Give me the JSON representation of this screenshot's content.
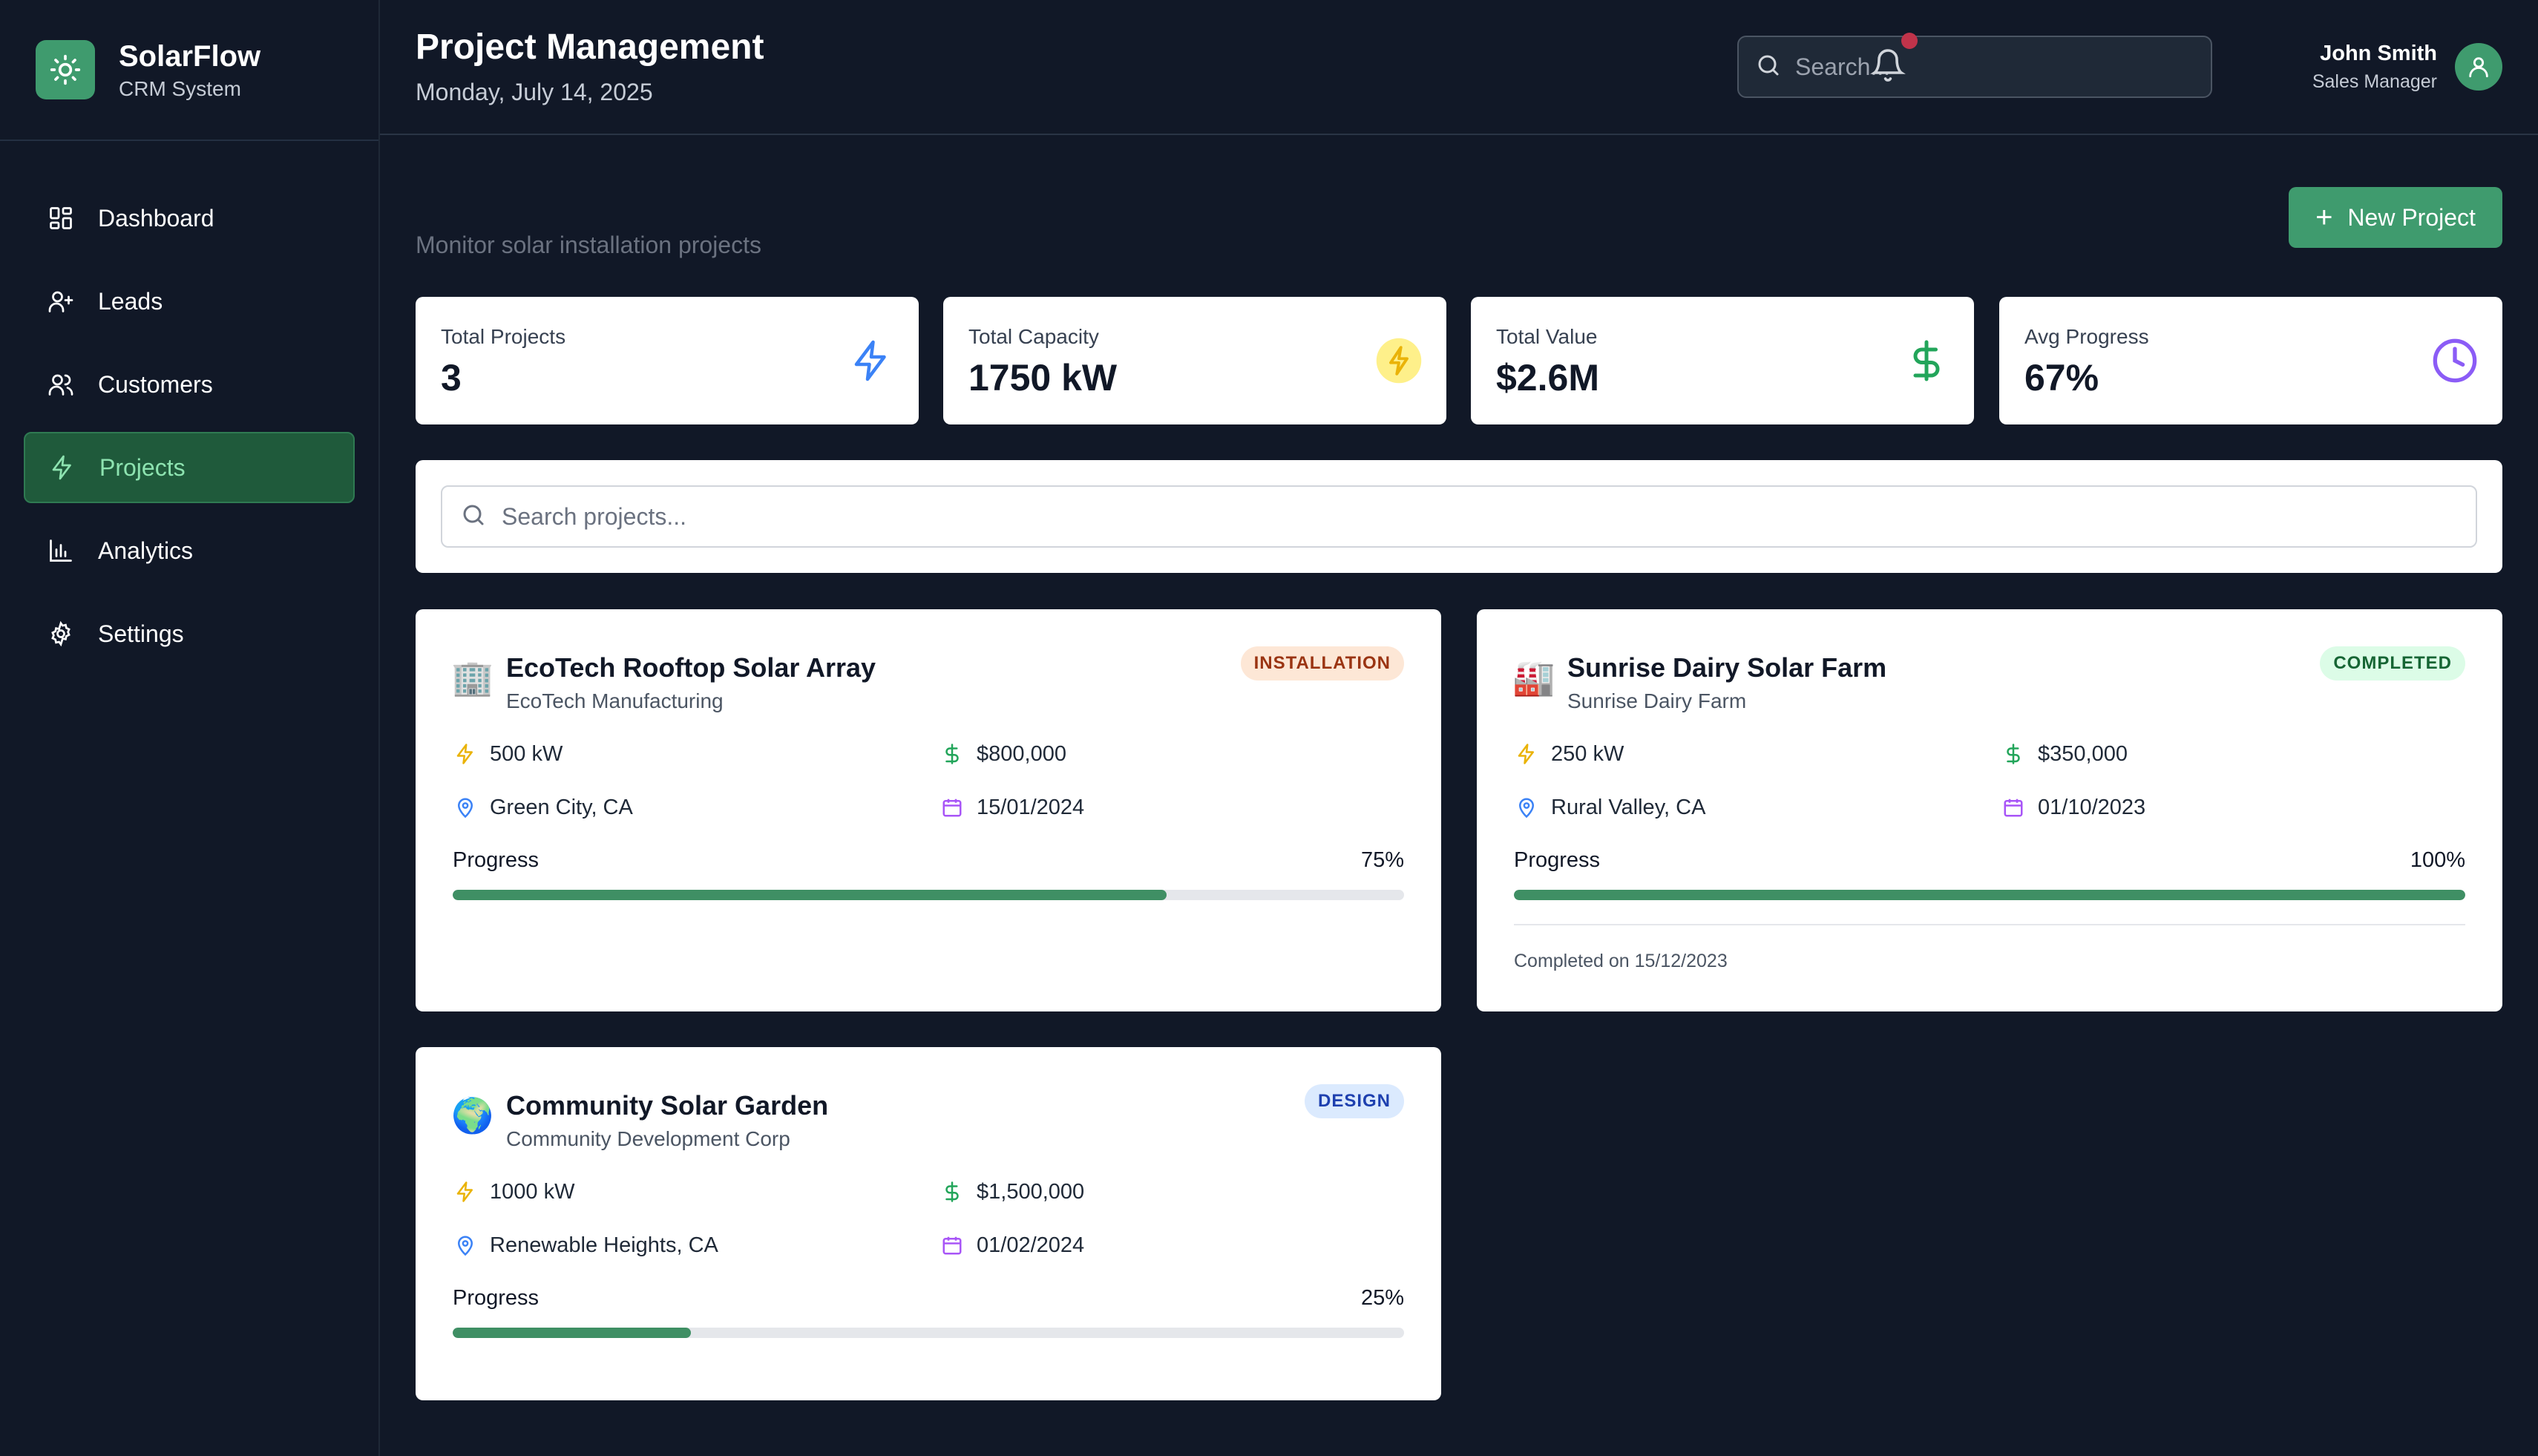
{
  "brand": {
    "name": "SolarFlow",
    "subtitle": "CRM System",
    "logo_icon": "sun-icon",
    "accent": "#3f9b6e"
  },
  "sidebar": {
    "items": [
      {
        "label": "Dashboard",
        "icon": "grid-icon",
        "active": false
      },
      {
        "label": "Leads",
        "icon": "user-plus-icon",
        "active": false
      },
      {
        "label": "Customers",
        "icon": "users-icon",
        "active": false
      },
      {
        "label": "Projects",
        "icon": "bolt-icon",
        "active": true
      },
      {
        "label": "Analytics",
        "icon": "bar-chart-icon",
        "active": false
      },
      {
        "label": "Settings",
        "icon": "gear-icon",
        "active": false
      }
    ]
  },
  "header": {
    "title": "Project Management",
    "date": "Monday, July 14, 2025",
    "search_placeholder": "Search...",
    "user": {
      "name": "John Smith",
      "role": "Sales Manager"
    }
  },
  "main": {
    "subtitle": "Monitor solar installation projects",
    "new_project_label": "New Project",
    "stats": [
      {
        "label": "Total Projects",
        "value": "3",
        "icon": "bolt-icon"
      },
      {
        "label": "Total Capacity",
        "value": "1750 kW",
        "icon": "bolt-circle-icon"
      },
      {
        "label": "Total Value",
        "value": "$2.6M",
        "icon": "dollar-icon"
      },
      {
        "label": "Avg Progress",
        "value": "67%",
        "icon": "clock-icon"
      }
    ],
    "project_search_placeholder": "Search projects...",
    "projects": [
      {
        "emoji": "🏢",
        "title": "EcoTech Rooftop Solar Array",
        "client": "EcoTech Manufacturing",
        "status": "INSTALLATION",
        "capacity": "500 kW",
        "value": "$800,000",
        "location": "Green City, CA",
        "date": "15/01/2024",
        "progress_label": "Progress",
        "progress_text": "75%",
        "progress": 0.75
      },
      {
        "emoji": "🏭",
        "title": "Sunrise Dairy Solar Farm",
        "client": "Sunrise Dairy Farm",
        "status": "COMPLETED",
        "capacity": "250 kW",
        "value": "$350,000",
        "location": "Rural Valley, CA",
        "date": "01/10/2023",
        "progress_label": "Progress",
        "progress_text": "100%",
        "progress": 1.0,
        "completed_note": "Completed on 15/12/2023"
      },
      {
        "emoji": "🌍",
        "title": "Community Solar Garden",
        "client": "Community Development Corp",
        "status": "DESIGN",
        "capacity": "1000 kW",
        "value": "$1,500,000",
        "location": "Renewable Heights, CA",
        "date": "01/02/2024",
        "progress_label": "Progress",
        "progress_text": "25%",
        "progress": 0.25
      }
    ]
  }
}
